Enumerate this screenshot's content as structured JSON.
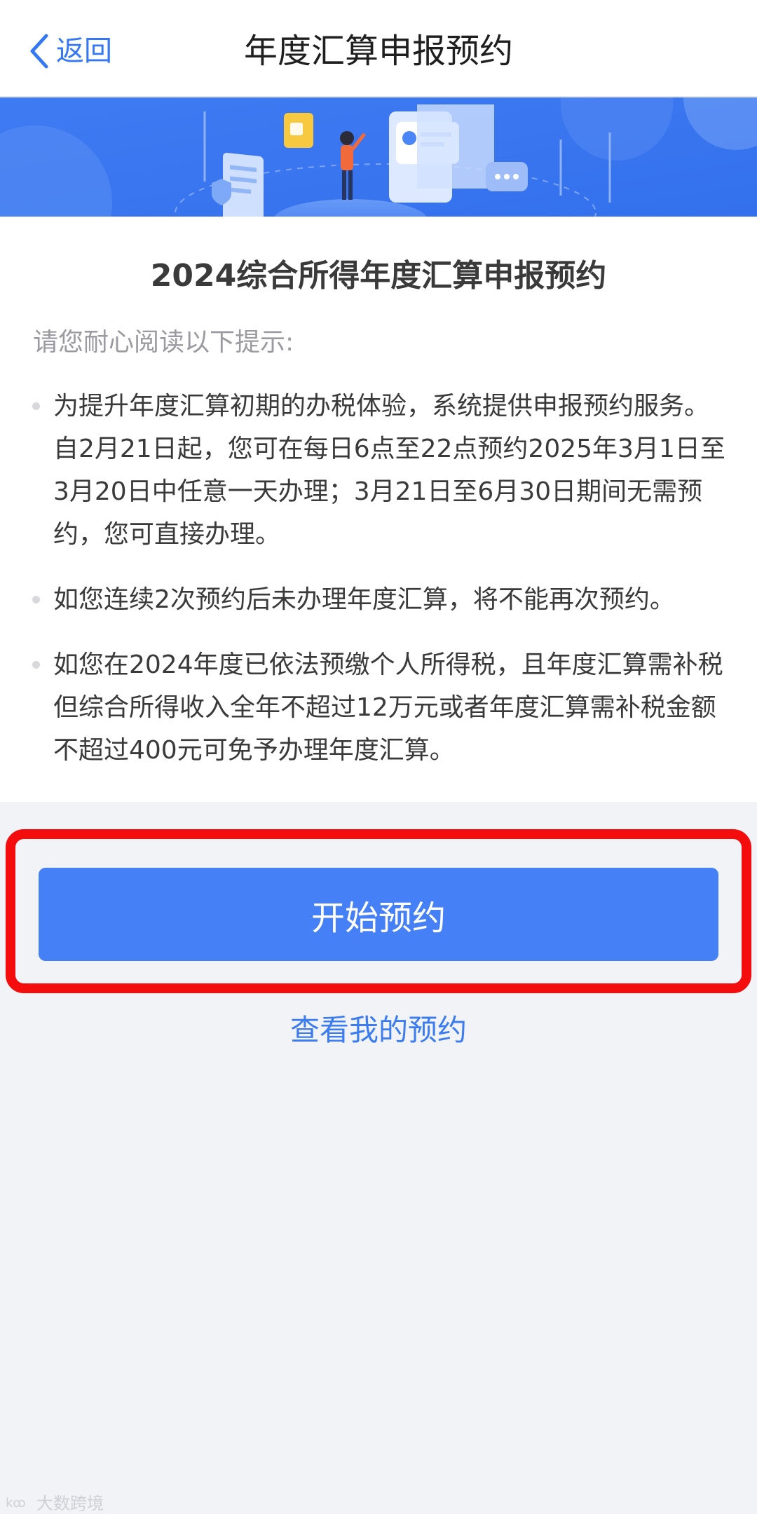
{
  "navbar": {
    "back_label": "返回",
    "title": "年度汇算申报预约"
  },
  "card": {
    "title": "2024综合所得年度汇算申报预约",
    "hint": "请您耐心阅读以下提示:",
    "bullets": [
      "为提升年度汇算初期的办税体验，系统提供申报预约服务。自2月21日起，您可在每日6点至22点预约2025年3月1日至3月20日中任意一天办理；3月21日至6月30日期间无需预约，您可直接办理。",
      "如您连续2次预约后未办理年度汇算，将不能再次预约。",
      "如您在2024年度已依法预缴个人所得税，且年度汇算需补税但综合所得收入全年不超过12万元或者年度汇算需补税金额不超过400元可免予办理年度汇算。"
    ]
  },
  "actions": {
    "start_label": "开始预约",
    "view_label": "查看我的预约"
  },
  "watermark": {
    "text": "大数跨境"
  },
  "colors": {
    "accent": "#4680f6",
    "link": "#3b7cf0",
    "highlight_frame": "#f30d0d",
    "page_bg": "#f2f3f7"
  },
  "icons": {
    "back": "chevron-left-icon",
    "banner": "banner-illustration"
  }
}
